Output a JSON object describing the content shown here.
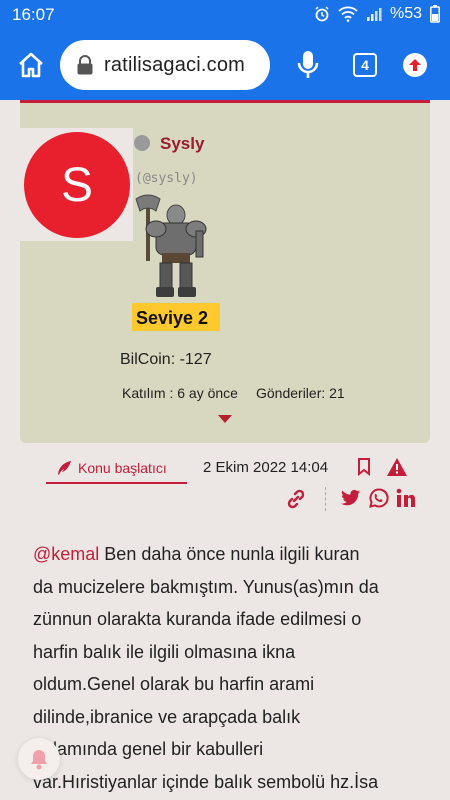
{
  "status_bar": {
    "time": "16:07",
    "battery": "%53"
  },
  "browser": {
    "url": "ratilisagaci.com",
    "tab_count": "4"
  },
  "profile": {
    "avatar_letter": "S",
    "username": "Sysly",
    "handle": "(@sysly)",
    "level": "Seviye 2",
    "bilcoin": "BilCoin: -127",
    "joined": "Katılım : 6 ay önce",
    "posts": "Gönderiler: 21"
  },
  "post": {
    "badge": "Konu başlatıcı",
    "date": "2 Ekim 2022 14:04",
    "mention": "@kemal",
    "lines": [
      " Ben daha önce nunla ilgili kuran",
      "da mucizelere bakmıştım. Yunus(as)mın da",
      "zünnun olarakta kuranda ifade edilmesi o",
      "harfin balık ile ilgili olmasına ikna",
      "oldum.Genel olarak bu harfin arami",
      "dilinde,ibranice ve arapçada balık",
      "anlamında genel bir kabulleri",
      "var.Hıristiyanlar içinde balık sembolü hz.İsa"
    ]
  },
  "colors": {
    "browser_blue": "#1a73e8",
    "accent_red": "#c41e3a",
    "card_bg": "#d8d8c0",
    "page_bg": "#ece7e4",
    "level_yellow": "#ffc82c"
  },
  "icons": [
    "home-icon",
    "lock-icon",
    "mic-icon",
    "tabs-icon",
    "upload-icon",
    "quill-icon",
    "bookmark-icon",
    "warning-icon",
    "link-icon",
    "twitter-icon",
    "whatsapp-icon",
    "linkedin-icon",
    "bell-icon"
  ]
}
